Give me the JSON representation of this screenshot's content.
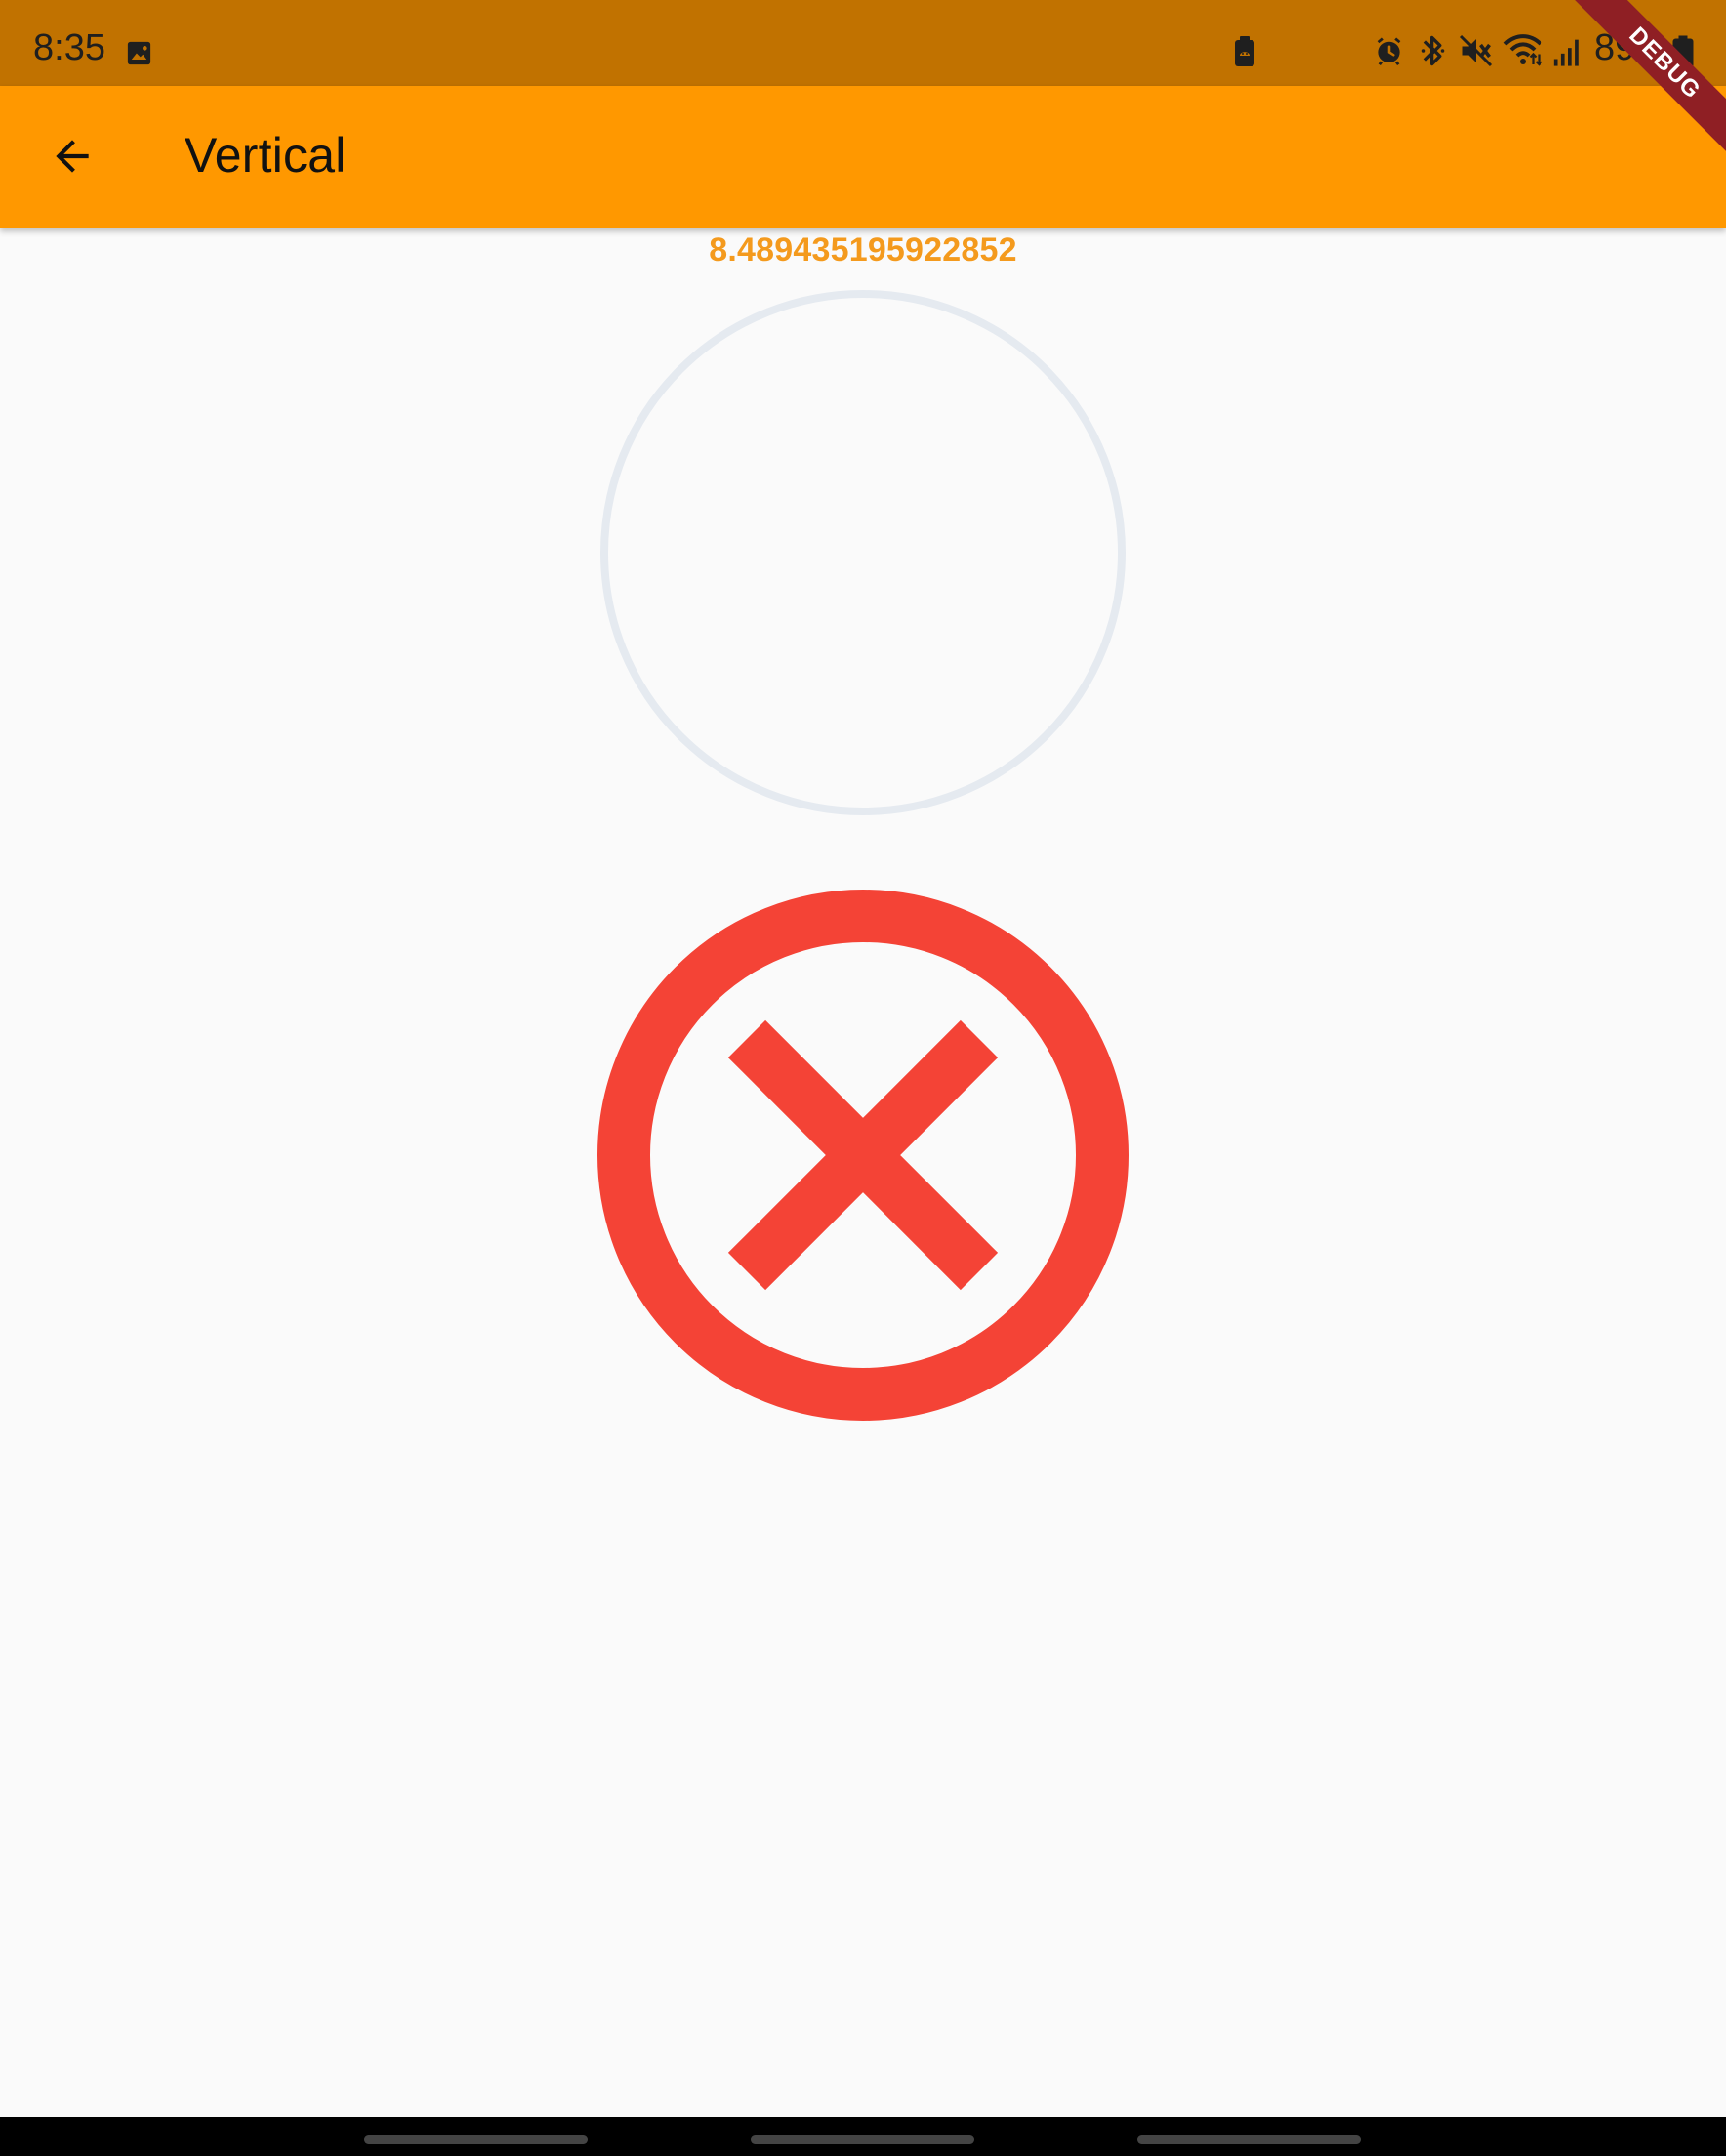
{
  "status_bar": {
    "time": "8:35",
    "battery": "89",
    "icons": [
      "image-icon",
      "android-notification-icon",
      "alarm-icon",
      "bluetooth-icon",
      "mute-icon",
      "wifi-icon",
      "signal-icon",
      "battery-icon"
    ]
  },
  "app_bar": {
    "title": "Vertical",
    "back_icon": "arrow-back-icon"
  },
  "main": {
    "value": "8.489435195922852",
    "error_icon": "cancel-icon"
  },
  "debug_banner": {
    "label": "DEBUG"
  },
  "colors": {
    "status_bar": "#c17200",
    "app_bar": "#ff9800",
    "value_text": "#f49a1d",
    "progress_track": "#e5eaf0",
    "error": "#f44336",
    "background": "#fafafa",
    "debug": "#8f1f24"
  }
}
